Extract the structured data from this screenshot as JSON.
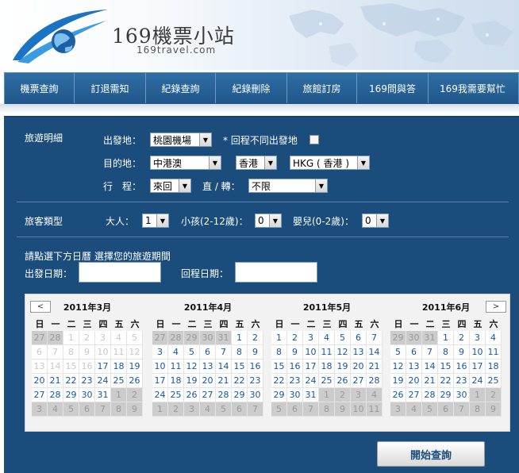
{
  "header": {
    "brand_title": "169機票小站",
    "brand_url": "169travel.com"
  },
  "nav": {
    "items": [
      "機票查詢",
      "訂退需知",
      "紀錄查詢",
      "紀錄刪除",
      "旅館訂房",
      "169問與答",
      "169我需要幫忙"
    ]
  },
  "trip": {
    "section_label": "旅遊明細",
    "origin_label": "出發地：",
    "origin_value": "桃園機場",
    "diff_return_label": "* 回程不同出發地",
    "dest_label": "目的地：",
    "dest_region": "中港澳",
    "dest_city": "香港",
    "dest_airport": "HKG ( 香港 )",
    "itinerary_label": "行　程：",
    "itinerary_value": "來回",
    "direct_label": "直 / 轉：",
    "direct_value": "不限"
  },
  "passengers": {
    "section_label": "旅客類型",
    "adult_label": "大人：",
    "adult_value": "1",
    "child_label": "小孩(2-12歲)：",
    "child_value": "0",
    "infant_label": "嬰兒(0-2歲)：",
    "infant_value": "0"
  },
  "dates": {
    "instruction": "請點選下方日曆 選擇您的旅遊期間",
    "depart_label": "出發日期：",
    "return_label": "回程日期："
  },
  "calendar": {
    "prev": "<",
    "next": ">",
    "weekdays": [
      "日",
      "一",
      "二",
      "三",
      "四",
      "五",
      "六"
    ],
    "months": [
      {
        "title": "2011年3月",
        "days": [
          {
            "d": "27",
            "s": "grey"
          },
          {
            "d": "28",
            "s": "grey"
          },
          {
            "d": "1",
            "s": "dis"
          },
          {
            "d": "2",
            "s": "dis"
          },
          {
            "d": "3",
            "s": "dis"
          },
          {
            "d": "4",
            "s": "dis"
          },
          {
            "d": "5",
            "s": "dis"
          },
          {
            "d": "6",
            "s": "dis"
          },
          {
            "d": "7",
            "s": "dis"
          },
          {
            "d": "8",
            "s": "dis"
          },
          {
            "d": "9",
            "s": "dis"
          },
          {
            "d": "10",
            "s": "dis"
          },
          {
            "d": "11",
            "s": "dis"
          },
          {
            "d": "12",
            "s": "dis"
          },
          {
            "d": "13",
            "s": "dis"
          },
          {
            "d": "14",
            "s": "dis"
          },
          {
            "d": "15",
            "s": "dis"
          },
          {
            "d": "16",
            "s": "dis"
          },
          {
            "d": "17",
            "s": "on"
          },
          {
            "d": "18",
            "s": "on"
          },
          {
            "d": "19",
            "s": "on"
          },
          {
            "d": "20",
            "s": "on"
          },
          {
            "d": "21",
            "s": "on"
          },
          {
            "d": "22",
            "s": "on"
          },
          {
            "d": "23",
            "s": "on"
          },
          {
            "d": "24",
            "s": "on"
          },
          {
            "d": "25",
            "s": "on"
          },
          {
            "d": "26",
            "s": "on"
          },
          {
            "d": "27",
            "s": "on"
          },
          {
            "d": "28",
            "s": "on"
          },
          {
            "d": "29",
            "s": "on"
          },
          {
            "d": "30",
            "s": "on"
          },
          {
            "d": "31",
            "s": "on"
          },
          {
            "d": "1",
            "s": "grey"
          },
          {
            "d": "2",
            "s": "grey"
          },
          {
            "d": "3",
            "s": "grey"
          },
          {
            "d": "4",
            "s": "grey"
          },
          {
            "d": "5",
            "s": "grey"
          },
          {
            "d": "6",
            "s": "grey"
          },
          {
            "d": "7",
            "s": "grey"
          },
          {
            "d": "8",
            "s": "grey"
          },
          {
            "d": "9",
            "s": "grey"
          }
        ]
      },
      {
        "title": "2011年4月",
        "days": [
          {
            "d": "27",
            "s": "grey"
          },
          {
            "d": "28",
            "s": "grey"
          },
          {
            "d": "29",
            "s": "grey"
          },
          {
            "d": "30",
            "s": "grey"
          },
          {
            "d": "31",
            "s": "grey"
          },
          {
            "d": "1",
            "s": "on"
          },
          {
            "d": "2",
            "s": "on"
          },
          {
            "d": "3",
            "s": "on"
          },
          {
            "d": "4",
            "s": "on"
          },
          {
            "d": "5",
            "s": "on"
          },
          {
            "d": "6",
            "s": "on"
          },
          {
            "d": "7",
            "s": "on"
          },
          {
            "d": "8",
            "s": "on"
          },
          {
            "d": "9",
            "s": "on"
          },
          {
            "d": "10",
            "s": "on"
          },
          {
            "d": "11",
            "s": "on"
          },
          {
            "d": "12",
            "s": "on"
          },
          {
            "d": "13",
            "s": "on"
          },
          {
            "d": "14",
            "s": "on"
          },
          {
            "d": "15",
            "s": "on"
          },
          {
            "d": "16",
            "s": "on"
          },
          {
            "d": "17",
            "s": "on"
          },
          {
            "d": "18",
            "s": "on"
          },
          {
            "d": "19",
            "s": "on"
          },
          {
            "d": "20",
            "s": "on"
          },
          {
            "d": "21",
            "s": "on"
          },
          {
            "d": "22",
            "s": "on"
          },
          {
            "d": "23",
            "s": "on"
          },
          {
            "d": "24",
            "s": "on"
          },
          {
            "d": "25",
            "s": "on"
          },
          {
            "d": "26",
            "s": "on"
          },
          {
            "d": "27",
            "s": "on"
          },
          {
            "d": "28",
            "s": "on"
          },
          {
            "d": "29",
            "s": "on"
          },
          {
            "d": "30",
            "s": "on"
          },
          {
            "d": "1",
            "s": "grey"
          },
          {
            "d": "2",
            "s": "grey"
          },
          {
            "d": "3",
            "s": "grey"
          },
          {
            "d": "4",
            "s": "grey"
          },
          {
            "d": "5",
            "s": "grey"
          },
          {
            "d": "6",
            "s": "grey"
          },
          {
            "d": "7",
            "s": "grey"
          }
        ]
      },
      {
        "title": "2011年5月",
        "days": [
          {
            "d": "1",
            "s": "on"
          },
          {
            "d": "2",
            "s": "on"
          },
          {
            "d": "3",
            "s": "on"
          },
          {
            "d": "4",
            "s": "on"
          },
          {
            "d": "5",
            "s": "on"
          },
          {
            "d": "6",
            "s": "on"
          },
          {
            "d": "7",
            "s": "on"
          },
          {
            "d": "8",
            "s": "on"
          },
          {
            "d": "9",
            "s": "on"
          },
          {
            "d": "10",
            "s": "on"
          },
          {
            "d": "11",
            "s": "on"
          },
          {
            "d": "12",
            "s": "on"
          },
          {
            "d": "13",
            "s": "on"
          },
          {
            "d": "14",
            "s": "on"
          },
          {
            "d": "15",
            "s": "on"
          },
          {
            "d": "16",
            "s": "on"
          },
          {
            "d": "17",
            "s": "on"
          },
          {
            "d": "18",
            "s": "on"
          },
          {
            "d": "19",
            "s": "on"
          },
          {
            "d": "20",
            "s": "on"
          },
          {
            "d": "21",
            "s": "on"
          },
          {
            "d": "22",
            "s": "on"
          },
          {
            "d": "23",
            "s": "on"
          },
          {
            "d": "24",
            "s": "on"
          },
          {
            "d": "25",
            "s": "on"
          },
          {
            "d": "26",
            "s": "on"
          },
          {
            "d": "27",
            "s": "on"
          },
          {
            "d": "28",
            "s": "on"
          },
          {
            "d": "29",
            "s": "on"
          },
          {
            "d": "30",
            "s": "on"
          },
          {
            "d": "31",
            "s": "on"
          },
          {
            "d": "1",
            "s": "grey"
          },
          {
            "d": "2",
            "s": "grey"
          },
          {
            "d": "3",
            "s": "grey"
          },
          {
            "d": "4",
            "s": "grey"
          },
          {
            "d": "5",
            "s": "grey"
          },
          {
            "d": "6",
            "s": "grey"
          },
          {
            "d": "7",
            "s": "grey"
          },
          {
            "d": "8",
            "s": "grey"
          },
          {
            "d": "9",
            "s": "grey"
          },
          {
            "d": "10",
            "s": "grey"
          },
          {
            "d": "11",
            "s": "grey"
          }
        ]
      },
      {
        "title": "2011年6月",
        "days": [
          {
            "d": "29",
            "s": "grey"
          },
          {
            "d": "30",
            "s": "grey"
          },
          {
            "d": "31",
            "s": "grey"
          },
          {
            "d": "1",
            "s": "on"
          },
          {
            "d": "2",
            "s": "on"
          },
          {
            "d": "3",
            "s": "on"
          },
          {
            "d": "4",
            "s": "on"
          },
          {
            "d": "5",
            "s": "on"
          },
          {
            "d": "6",
            "s": "on"
          },
          {
            "d": "7",
            "s": "on"
          },
          {
            "d": "8",
            "s": "on"
          },
          {
            "d": "9",
            "s": "on"
          },
          {
            "d": "10",
            "s": "on"
          },
          {
            "d": "11",
            "s": "on"
          },
          {
            "d": "12",
            "s": "on"
          },
          {
            "d": "13",
            "s": "on"
          },
          {
            "d": "14",
            "s": "on"
          },
          {
            "d": "15",
            "s": "on"
          },
          {
            "d": "16",
            "s": "on"
          },
          {
            "d": "17",
            "s": "on"
          },
          {
            "d": "18",
            "s": "on"
          },
          {
            "d": "19",
            "s": "on"
          },
          {
            "d": "20",
            "s": "on"
          },
          {
            "d": "21",
            "s": "on"
          },
          {
            "d": "22",
            "s": "on"
          },
          {
            "d": "23",
            "s": "on"
          },
          {
            "d": "24",
            "s": "on"
          },
          {
            "d": "25",
            "s": "on"
          },
          {
            "d": "26",
            "s": "on"
          },
          {
            "d": "27",
            "s": "on"
          },
          {
            "d": "28",
            "s": "on"
          },
          {
            "d": "29",
            "s": "on"
          },
          {
            "d": "30",
            "s": "on"
          },
          {
            "d": "1",
            "s": "grey"
          },
          {
            "d": "2",
            "s": "grey"
          },
          {
            "d": "3",
            "s": "grey"
          },
          {
            "d": "4",
            "s": "grey"
          },
          {
            "d": "5",
            "s": "grey"
          },
          {
            "d": "6",
            "s": "grey"
          },
          {
            "d": "7",
            "s": "grey"
          },
          {
            "d": "8",
            "s": "grey"
          },
          {
            "d": "9",
            "s": "grey"
          }
        ]
      }
    ]
  },
  "search_button": "開始查詢",
  "colors": {
    "panel": "#1a4c7c",
    "nav": "#2a6499",
    "link_day": "#1157a9",
    "grey_day": "#cccccc"
  }
}
